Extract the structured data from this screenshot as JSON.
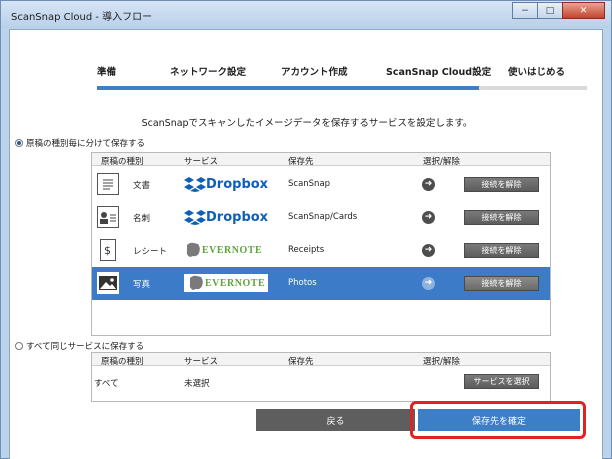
{
  "window": {
    "title": "ScanSnap Cloud - 導入フロー",
    "minimize": "−",
    "maximize": "□",
    "close": "✕"
  },
  "steps": [
    "準備",
    "ネットワーク設定",
    "アカウント作成",
    "ScanSnap Cloud設定",
    "使いはじめる"
  ],
  "progress": {
    "current_step": 4,
    "total_steps": 5
  },
  "description": "ScanSnapでスキャンしたイメージデータを保存するサービスを設定します。",
  "option_by_type": {
    "label": "原稿の種別毎に分けて保存する",
    "selected": true,
    "headers": [
      "原稿の種別",
      "サービス",
      "保存先",
      "選択/解除"
    ],
    "rows": [
      {
        "icon": "document-icon",
        "type": "文書",
        "service": "Dropbox",
        "dest": "ScanSnap",
        "button": "接続を解除",
        "selected": false
      },
      {
        "icon": "business-card-icon",
        "type": "名刺",
        "service": "Dropbox",
        "dest": "ScanSnap/Cards",
        "button": "接続を解除",
        "selected": false
      },
      {
        "icon": "receipt-icon",
        "type": "レシート",
        "service": "EVERNOTE",
        "dest": "Receipts",
        "button": "接続を解除",
        "selected": false
      },
      {
        "icon": "photo-icon",
        "type": "写真",
        "service": "EVERNOTE",
        "dest": "Photos",
        "button": "接続を解除",
        "selected": true
      }
    ]
  },
  "option_same": {
    "label": "すべて同じサービスに保存する",
    "selected": false,
    "headers": [
      "原稿の種別",
      "サービス",
      "保存先",
      "選択/解除"
    ],
    "row": {
      "type": "すべて",
      "service": "未選択",
      "dest": "",
      "button": "サービスを選択"
    }
  },
  "footer": {
    "back": "戻る",
    "confirm": "保存先を確定"
  },
  "colors": {
    "accent": "#3c7fc6",
    "selected_row": "#3b7bc8",
    "highlight": "#e22222",
    "dropbox": "#0d5fb8",
    "evernote": "#5fa63b"
  }
}
